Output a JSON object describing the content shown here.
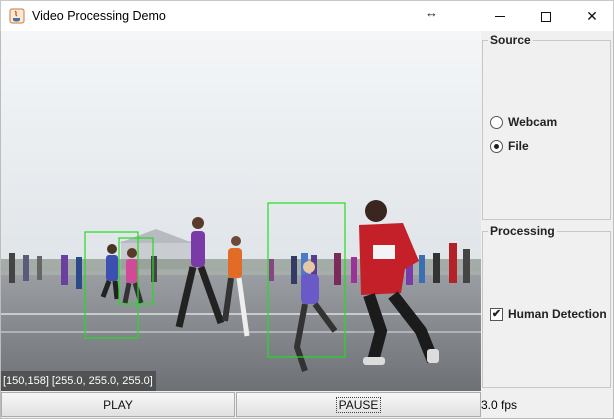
{
  "window": {
    "title": "Video Processing Demo",
    "resize_indicator": "↔",
    "controls": {
      "minimize": "minimize",
      "maximize": "maximize",
      "close": "✕"
    }
  },
  "video": {
    "pixel_readout": "[150,158] [255.0, 255.0, 255.0]",
    "detection_color": "#22dd22",
    "detections_count": 3
  },
  "controls": {
    "play_label": "PLAY",
    "pause_label": "PAUSE",
    "fps_text": "3.0 fps"
  },
  "source_group": {
    "title": "Source",
    "options": [
      {
        "label": "Webcam",
        "selected": false
      },
      {
        "label": "File",
        "selected": true
      }
    ]
  },
  "processing_group": {
    "title": "Processing",
    "human_detection_label": "Human Detection",
    "human_detection_checked": true
  },
  "colors": {
    "accent_detection": "#22dd22",
    "runner_shirt": "#c4202a"
  }
}
